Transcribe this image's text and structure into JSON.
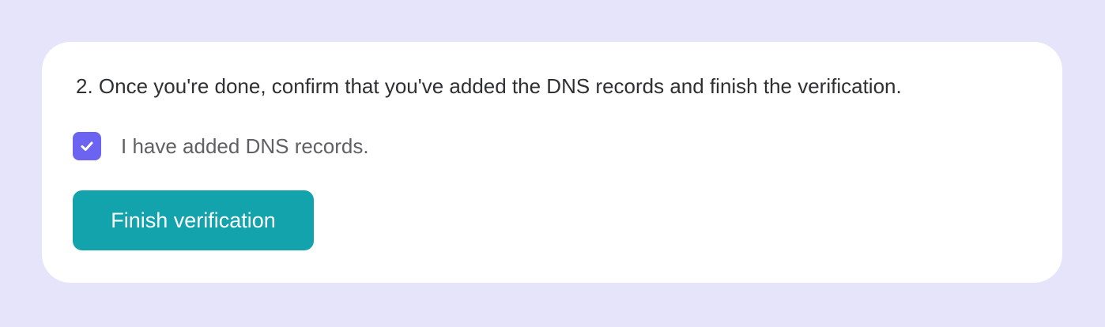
{
  "step": {
    "instruction": "2. Once you're done, confirm that you've added the DNS records and finish the verification."
  },
  "confirm": {
    "checked": true,
    "label": "I have added DNS records.",
    "icon": "check-icon"
  },
  "actions": {
    "finish_label": "Finish verification"
  },
  "colors": {
    "background": "#e6e4fa",
    "checkbox_accent": "#6c63f0",
    "button": "#13a3ad"
  }
}
